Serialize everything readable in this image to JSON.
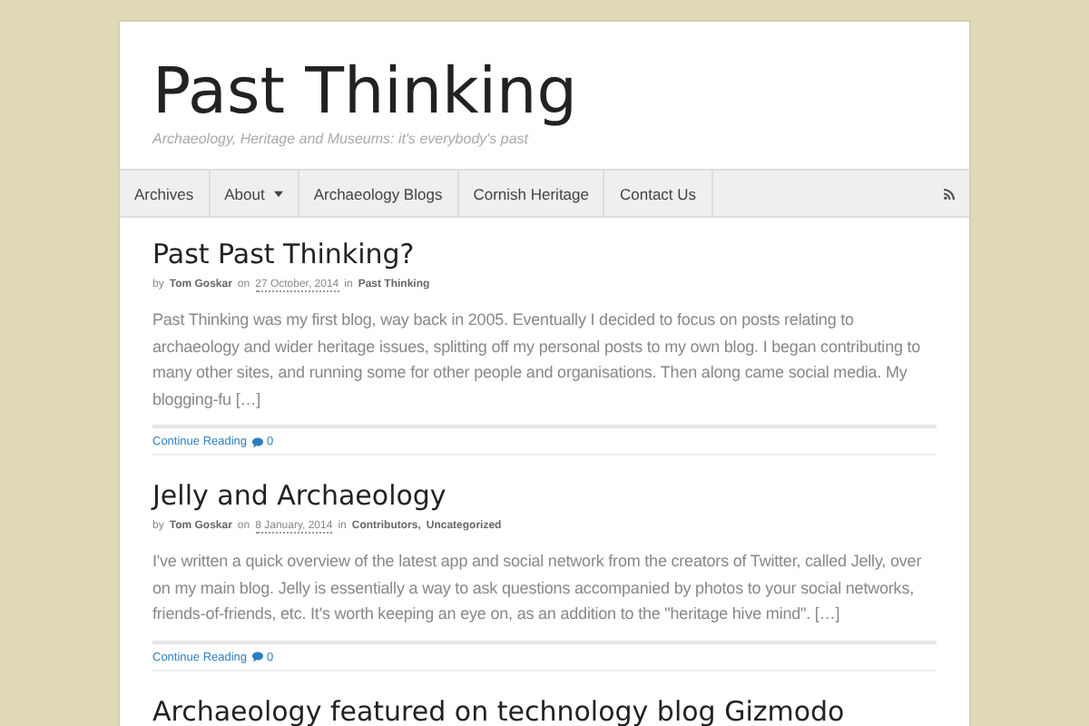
{
  "site": {
    "title": "Past Thinking",
    "tagline": "Archaeology, Heritage and Museums: it's everybody's past"
  },
  "nav": {
    "items": [
      {
        "label": "Archives",
        "has_menu": false
      },
      {
        "label": "About",
        "has_menu": true
      },
      {
        "label": "Archaeology Blogs",
        "has_menu": false
      },
      {
        "label": "Cornish Heritage",
        "has_menu": false
      },
      {
        "label": "Contact Us",
        "has_menu": false
      }
    ]
  },
  "posts": [
    {
      "title": "Past Past Thinking?",
      "meta": [
        {
          "kind": "text",
          "text": "by"
        },
        {
          "kind": "author",
          "text": "Tom Goskar"
        },
        {
          "kind": "text",
          "text": "on"
        },
        {
          "kind": "date",
          "text": "27 October, 2014"
        },
        {
          "kind": "text",
          "text": "in"
        },
        {
          "kind": "category",
          "text": "Past Thinking"
        }
      ],
      "excerpt": "Past Thinking was my first blog, way back in 2005. Eventually I decided to focus on posts relating to archaeology and wider heritage issues, splitting off my personal posts to my own blog. I began contributing to many other sites, and running some for other people and organisations. Then along came social media. My blogging-fu […]",
      "more": "Continue Reading",
      "comments": "0"
    },
    {
      "title": "Jelly and Archaeology",
      "meta": [
        {
          "kind": "text",
          "text": "by"
        },
        {
          "kind": "author",
          "text": "Tom Goskar"
        },
        {
          "kind": "text",
          "text": "on"
        },
        {
          "kind": "date",
          "text": "8 January, 2014"
        },
        {
          "kind": "text",
          "text": "in"
        },
        {
          "kind": "category",
          "text": "Contributors,"
        },
        {
          "kind": "category",
          "text": "Uncategorized"
        }
      ],
      "excerpt": "I've written a quick overview of the latest app and social network from the creators of Twitter, called Jelly, over on my main blog. Jelly is essentially a way to ask questions accompanied by photos to your social networks, friends-of-friends, etc. It's worth keeping an eye on, as an addition to the \"heritage hive mind\". […]",
      "more": "Continue Reading",
      "comments": "0"
    },
    {
      "title": "Archaeology featured on technology blog Gizmodo"
    }
  ]
}
